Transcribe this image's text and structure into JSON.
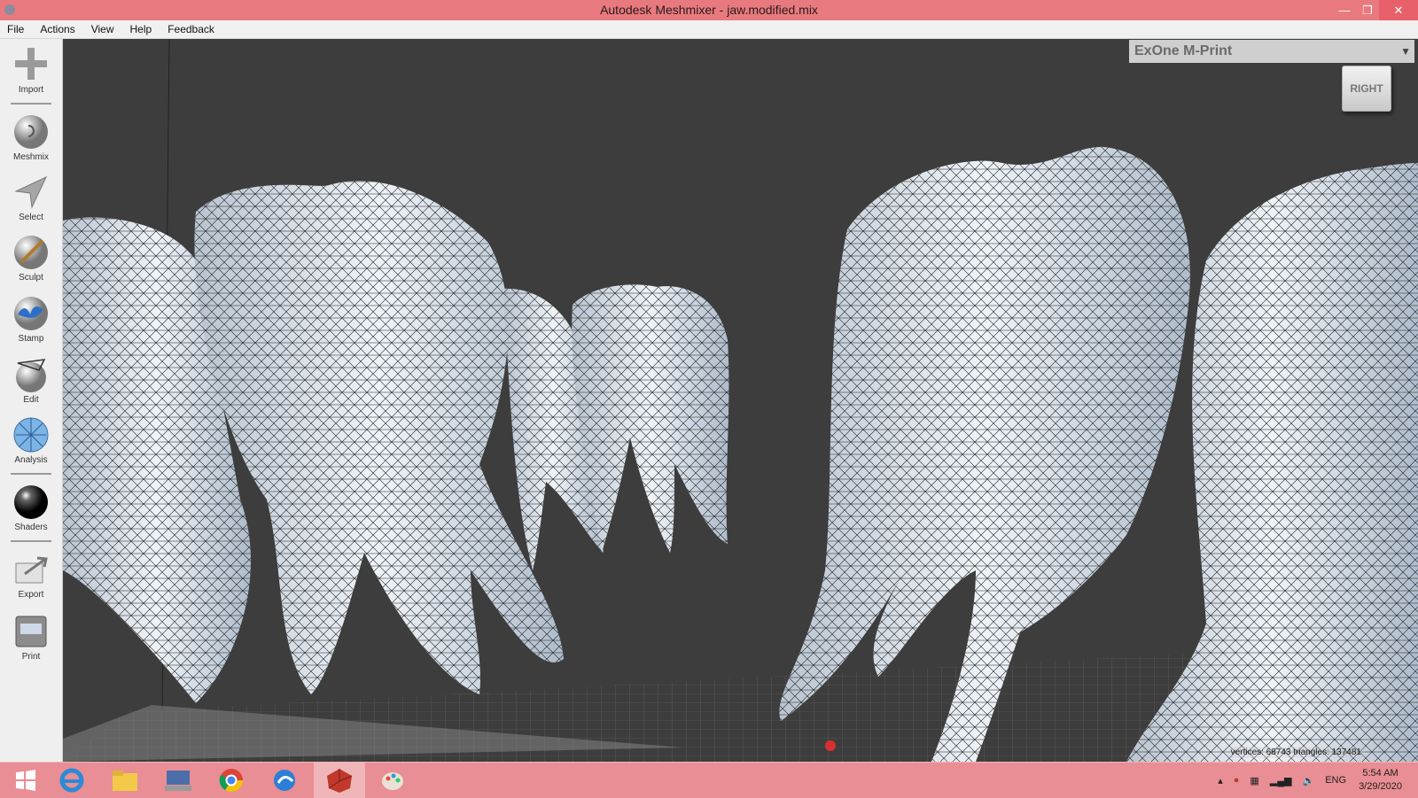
{
  "window": {
    "title": "Autodesk Meshmixer - jaw.modified.mix"
  },
  "menu": [
    "File",
    "Actions",
    "View",
    "Help",
    "Feedback"
  ],
  "tools": [
    {
      "label": "Import",
      "icon": "plus-icon"
    },
    {
      "label": "Meshmix",
      "icon": "meshmix-icon"
    },
    {
      "label": "Select",
      "icon": "select-arrow-icon"
    },
    {
      "label": "Sculpt",
      "icon": "sculpt-brush-icon"
    },
    {
      "label": "Stamp",
      "icon": "stamp-icon"
    },
    {
      "label": "Edit",
      "icon": "edit-icon"
    },
    {
      "label": "Analysis",
      "icon": "analysis-icon"
    },
    {
      "label": "Shaders",
      "icon": "shaders-icon"
    },
    {
      "label": "Export",
      "icon": "export-icon"
    },
    {
      "label": "Print",
      "icon": "print-icon"
    }
  ],
  "viewport": {
    "printer": "ExOne M-Print",
    "viewcube": "RIGHT",
    "stats": "vertices: 68743 triangles: 137481"
  },
  "taskbar": {
    "apps": [
      "start-icon",
      "internet-explorer-icon",
      "file-explorer-icon",
      "keyboard-app-icon",
      "chrome-icon",
      "browser-icon",
      "meshmixer-icon",
      "paint-icon"
    ],
    "language": "ENG",
    "time": "5:54 AM",
    "date": "3/29/2020"
  },
  "colors": {
    "titlebar": "#e87a7f",
    "taskbar": "#e98e94",
    "viewport_bg": "#3d3d3d",
    "tooth": "#dfe7ef"
  }
}
